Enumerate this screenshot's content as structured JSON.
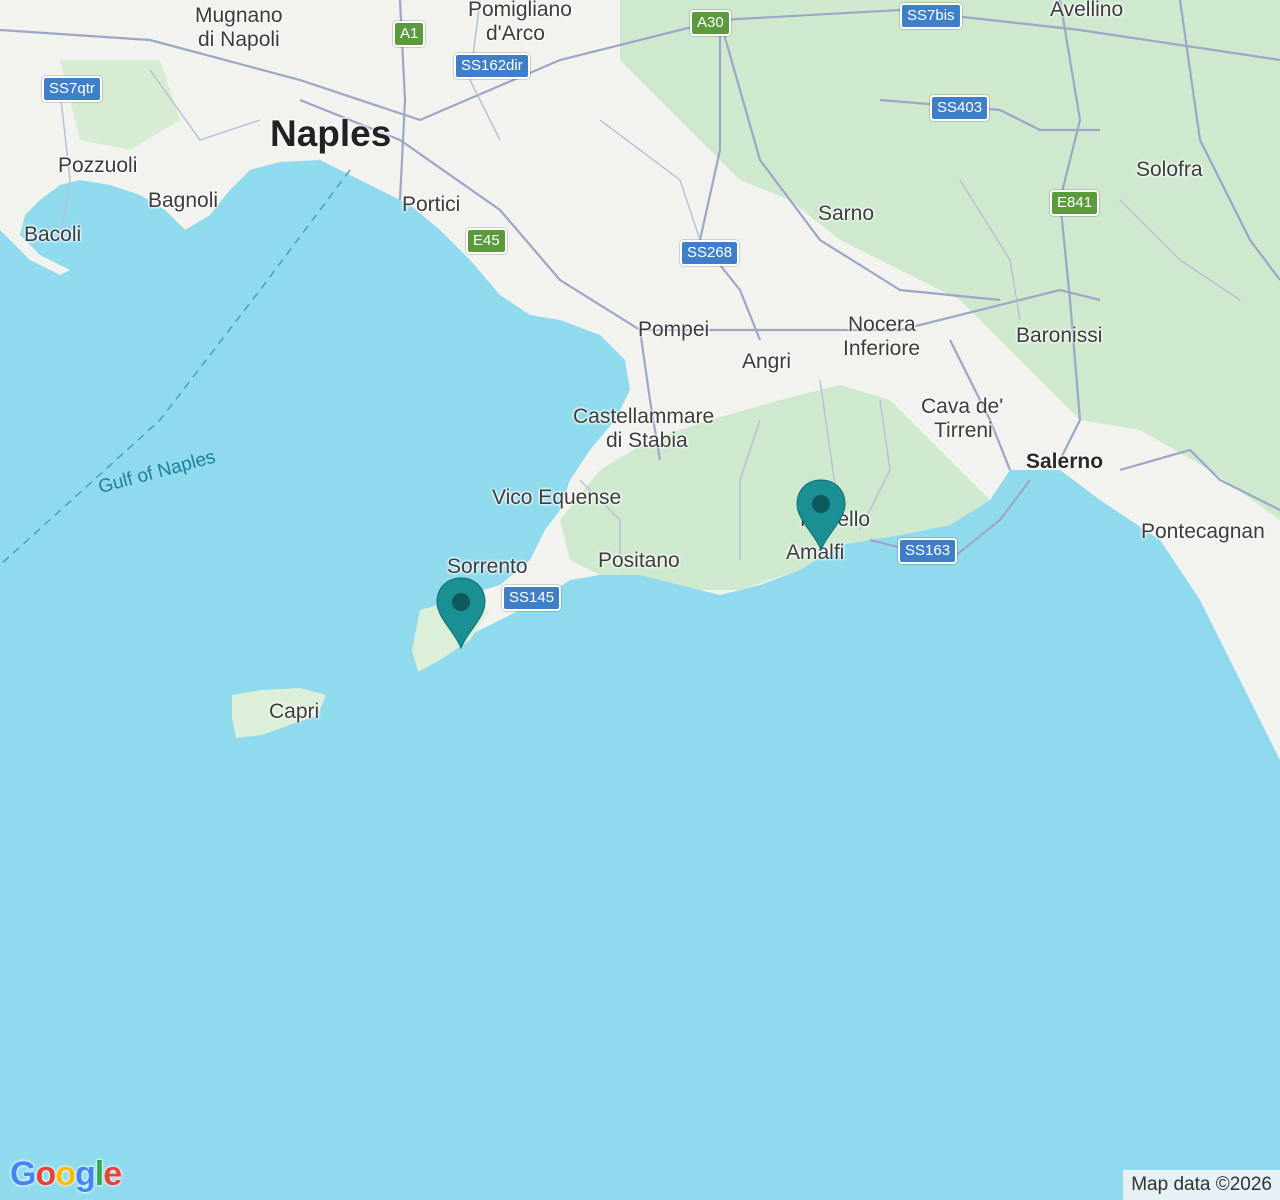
{
  "colors": {
    "sea": "#8fdbed",
    "land": "#f2f2ee",
    "forest": "#c8e8c8",
    "road": "#9aa7c7",
    "marker": "#1a8f94",
    "marker_dot": "#0e5a5e"
  },
  "places": {
    "mugnano": "Mugnano",
    "di_napoli": "di Napoli",
    "pomigliano": "Pomigliano",
    "darco": "d'Arco",
    "avellino": "Avellino",
    "naples": "Naples",
    "pozzuoli": "Pozzuoli",
    "bagnoli": "Bagnoli",
    "bacoli": "Bacoli",
    "portici": "Portici",
    "sarno": "Sarno",
    "solofra": "Solofra",
    "pompei": "Pompei",
    "nocera": "Nocera",
    "inferiore": "Inferiore",
    "baronissi": "Baronissi",
    "angri": "Angri",
    "castellammare": "Castellammare",
    "di_stabia": "di Stabia",
    "cava": "Cava de'",
    "tirreni": "Tirreni",
    "salerno": "Salerno",
    "gulf": "Gulf of Naples",
    "vico": "Vico Equense",
    "ravello": "Ravello",
    "amalfi": "Amalfi",
    "pontecagnano": "Pontecagnan",
    "sorrento": "Sorrento",
    "positano": "Positano",
    "capri": "Capri"
  },
  "roads": {
    "a1": "A1",
    "a30": "A30",
    "ss7bis": "SS7bis",
    "ss162dir": "SS162dir",
    "ss7qtr": "SS7qtr",
    "ss403": "SS403",
    "e841": "E841",
    "e45": "E45",
    "ss268": "SS268",
    "ss163": "SS163",
    "ss145": "SS145"
  },
  "markers": [
    {
      "name": "Marker near Sorrento peninsula",
      "icon": "map-pin-icon"
    },
    {
      "name": "Marker near Amalfi",
      "icon": "map-pin-icon"
    }
  ],
  "branding": {
    "logo_letters": [
      "G",
      "o",
      "o",
      "g",
      "l",
      "e"
    ],
    "logo_colors": [
      "#4285F4",
      "#EA4335",
      "#FBBC05",
      "#4285F4",
      "#34A853",
      "#EA4335"
    ],
    "attribution": "Map data ©2026"
  }
}
